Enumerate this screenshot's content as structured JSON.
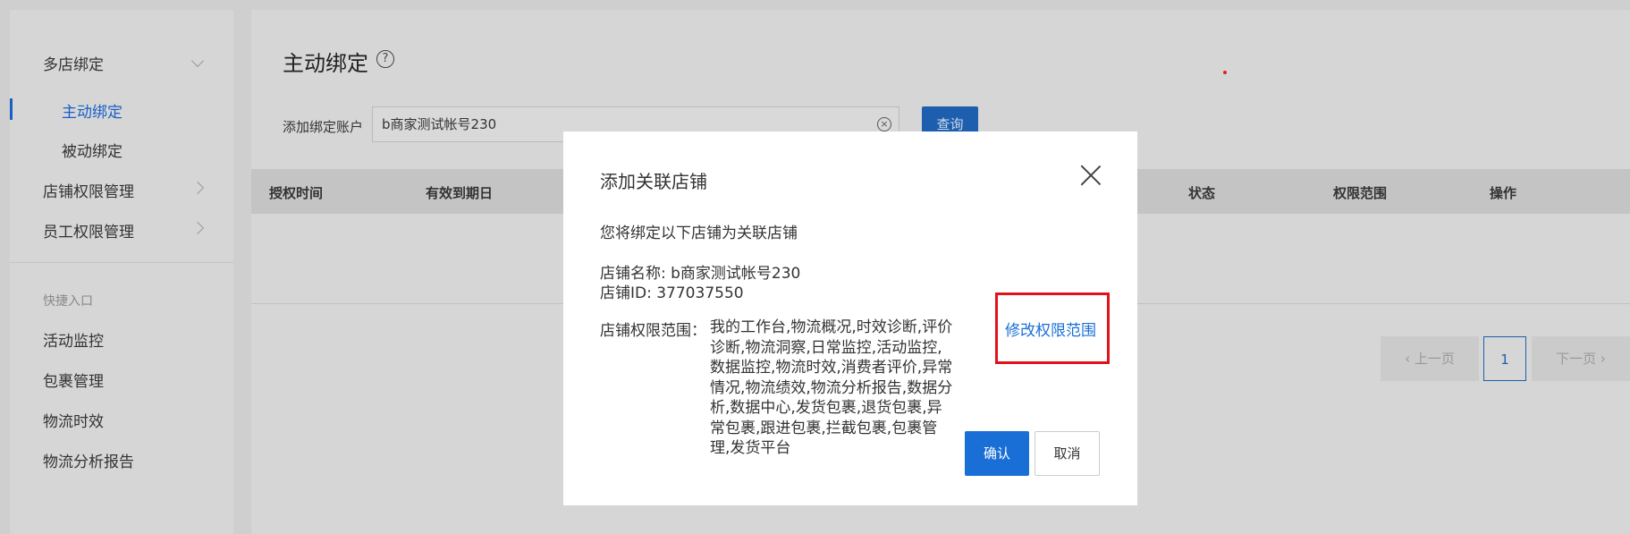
{
  "sidebar": {
    "groups": [
      {
        "label": "多店绑定"
      },
      {
        "label": "主动绑定"
      },
      {
        "label": "被动绑定"
      },
      {
        "label": "店铺权限管理"
      },
      {
        "label": "员工权限管理"
      }
    ],
    "shortcut_title": "快捷入口",
    "shortcuts": [
      {
        "label": "活动监控"
      },
      {
        "label": "包裹管理"
      },
      {
        "label": "物流时效"
      },
      {
        "label": "物流分析报告"
      }
    ]
  },
  "main": {
    "title": "主动绑定",
    "help_glyph": "?",
    "search": {
      "label": "添加绑定账户",
      "value": "b商家测试帐号230",
      "clear_glyph": "×",
      "button": "查询"
    },
    "table": {
      "columns": [
        "授权时间",
        "有效到期日",
        "状态",
        "权限范围",
        "操作"
      ]
    },
    "pagination": {
      "prev": "‹ 上一页",
      "current": "1",
      "next": "下一页 ›"
    }
  },
  "modal": {
    "title": "添加关联店铺",
    "intro": "您将绑定以下店铺为关联店铺",
    "shop_name": "店铺名称: b商家测试帐号230",
    "shop_id": "店铺ID: 377037550",
    "perm_label": "店铺权限范围：",
    "perm_value": "我的工作台,物流概况,时效诊断,评价诊断,物流洞察,日常监控,活动监控,数据监控,物流时效,消费者评价,异常情况,物流绩效,物流分析报告,数据分析,数据中心,发货包裹,退货包裹,异常包裹,跟进包裹,拦截包裹,包裹管理,发货平台",
    "edit_link": "修改权限范围",
    "confirm": "确认",
    "cancel": "取消"
  },
  "colors": {
    "primary": "#1a6fd6",
    "highlight": "#e0121b"
  }
}
